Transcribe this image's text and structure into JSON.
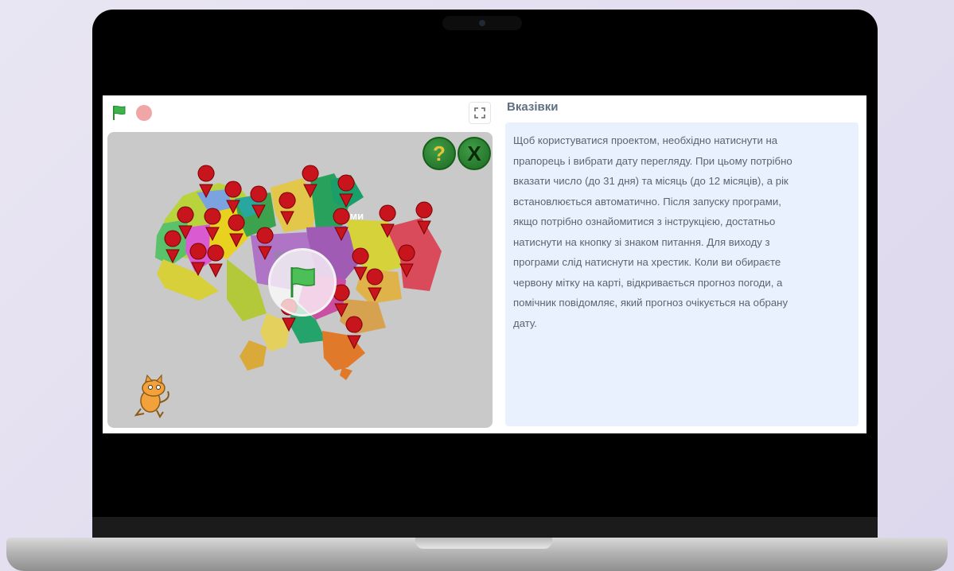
{
  "player": {
    "controls": {
      "start_icon": "green-flag-icon",
      "stop_icon": "stop-icon",
      "fullscreen_icon": "fullscreen-icon"
    },
    "stage": {
      "help_button_label": "?",
      "exit_button_label": "X",
      "region_label": "Суми"
    }
  },
  "instructions": {
    "title": "Вказівки",
    "text": "Щоб користуватися проектом, необхідно натиснути на\nпрапорець і вибрати дату перегляду. При цьому потрібно\nвказати число (до 31 дня) та місяць (до 12 місяців), а рік\nвстановлюється автоматично. Після запуску програми,\nякщо потрібно ознайомитися з інструкцією, достатньо\nнатиснути на кнопку зі знаком питання. Для виходу з\nпрограми слід натиснути на хрестик. Коли ви обираєте\nчервону мітку на карті, відкривається прогноз погоди, а\nпомічник повідомляє, який прогноз очікується на обрану\nдату."
  },
  "colors": {
    "stage_bg": "#c9c9c9",
    "pin": "#c8141c",
    "instructions_bg": "#e9f1ff",
    "flag_green": "#3db34a"
  }
}
